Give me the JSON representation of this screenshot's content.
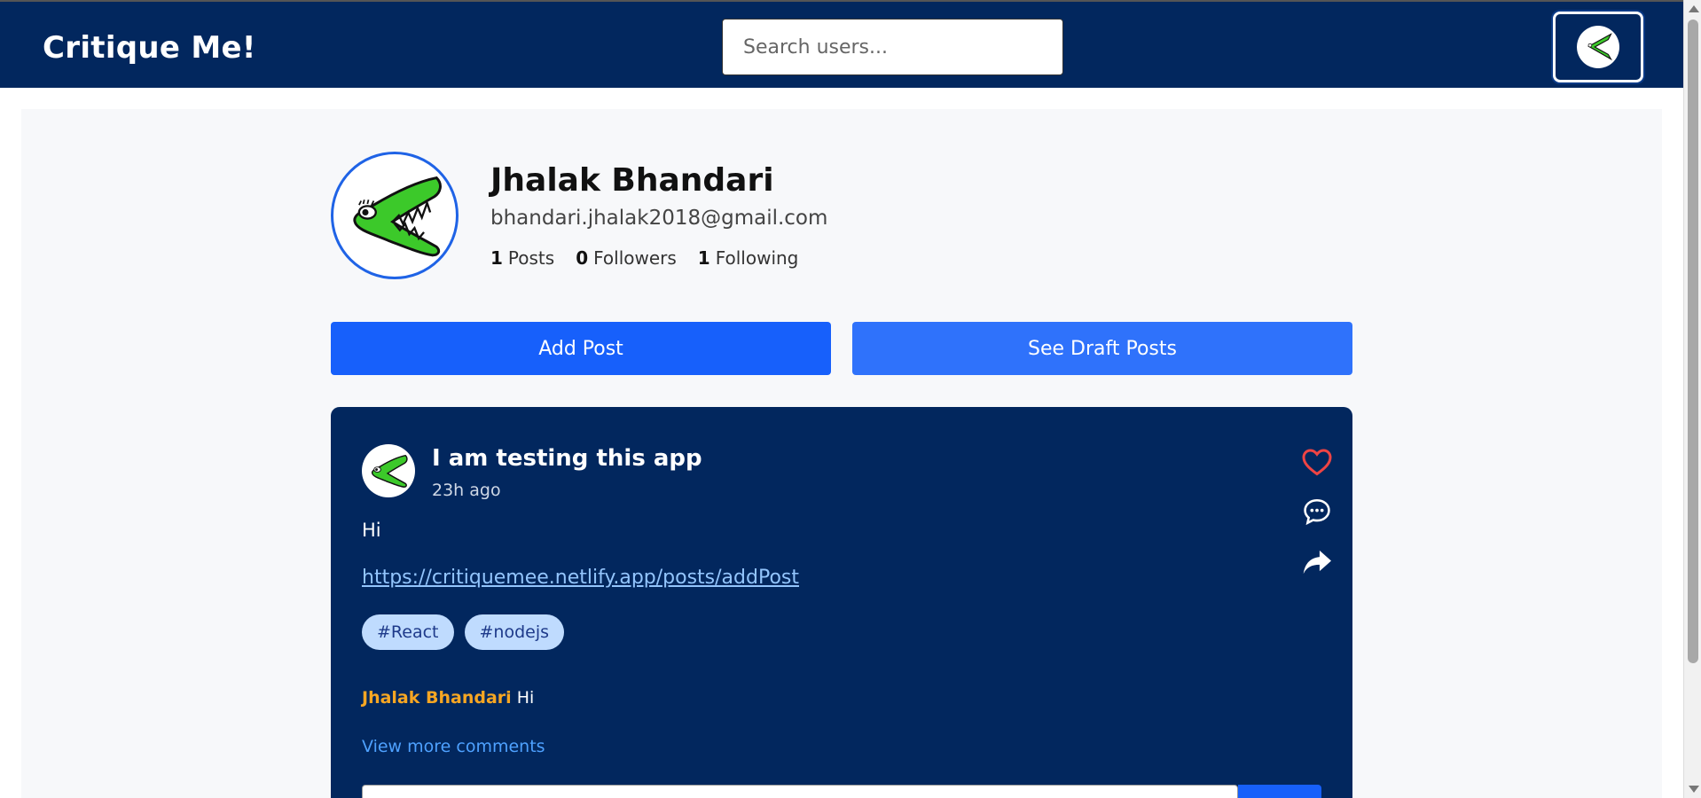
{
  "navbar": {
    "brand": "Critique Me!",
    "search_placeholder": "Search users...",
    "avatar_icon": "crocodile-avatar-icon"
  },
  "profile": {
    "name": "Jhalak Bhandari",
    "email": "bhandari.jhalak2018@gmail.com",
    "stats": {
      "posts_count": "1",
      "posts_label": "Posts",
      "followers_count": "0",
      "followers_label": "Followers",
      "following_count": "1",
      "following_label": "Following"
    }
  },
  "actions": {
    "add_post": "Add Post",
    "draft_posts": "See Draft Posts"
  },
  "post": {
    "title": "I am testing this app",
    "time": "23h ago",
    "body": "Hi",
    "link": "https://critiquemee.netlify.app/posts/addPost",
    "tags": [
      "#React",
      "#nodejs"
    ],
    "comment": {
      "author": "Jhalak Bhandari",
      "text": "Hi"
    },
    "view_more": "View more comments",
    "icons": [
      "heart-icon",
      "comment-icon",
      "share-icon"
    ]
  },
  "colors": {
    "navbar": "#02275e",
    "primary_button": "#1760fb",
    "secondary_button": "#2f72fb",
    "like": "#ef4444",
    "comment_author": "#f6a623",
    "link": "#93c5fd"
  }
}
